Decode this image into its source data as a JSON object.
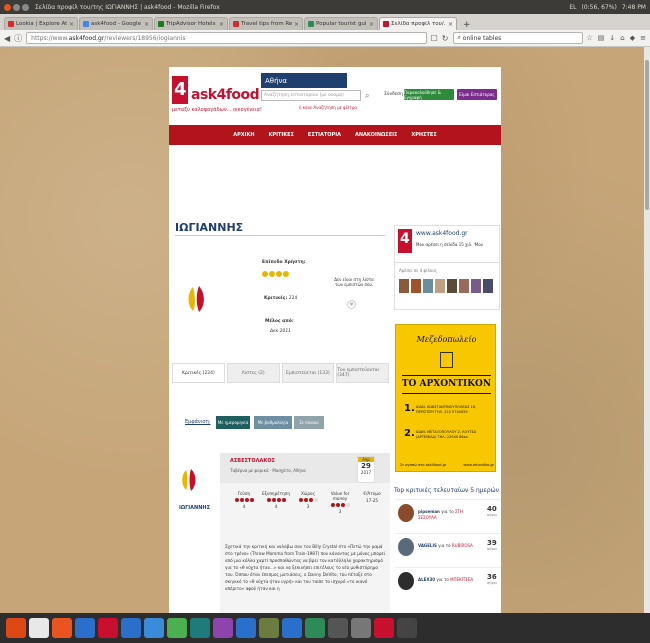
{
  "window_title": "Σελίδα προφίλ του/της ΙΩΓΙΑΝΝΗΣ | ask4food - Mozilla Firefox",
  "tray": {
    "input": "EL",
    "battery": "(0:56, 67%)",
    "time": "7:48 PM"
  },
  "tabs": [
    {
      "label": "Lookia | Explore At...",
      "color": "#d12d2d",
      "active": false
    },
    {
      "label": "ask4food - Google S...",
      "color": "#4285f4",
      "active": false
    },
    {
      "label": "TripAdvisor Hotels ...",
      "color": "#1f7a1f",
      "active": false
    },
    {
      "label": "Travel tips from Re...",
      "color": "#d12d2d",
      "active": false
    },
    {
      "label": "Popular tourist gui...",
      "color": "#2e8b57",
      "active": false
    },
    {
      "label": "Σελίδα προφίλ του/...",
      "color": "#c8102e",
      "active": true
    }
  ],
  "nav": {
    "url_prefix": "https://www.",
    "url_domain": "ask4food.gr",
    "url_path": "/reviewers/18956/iogiannis",
    "search_text": "online tables"
  },
  "site": {
    "logo": "ask4food",
    "tagline": "μεταξύ καλοφαγάδων... οικογένεια!",
    "city": "Αθήνα",
    "search_placeholder": "Αναζήτηση εστιατορίου (με ονομα)",
    "advanced_search": "ή κάνε Αναζήτηση με φίλτρα",
    "login": "Σύνδεση",
    "register_btn": "Παρακολούθησε & Εγγραφή",
    "owners_btn": "Είμαι Εστιάτορας",
    "menu": [
      "ΑΡΧΙΚΗ",
      "ΚΡΙΤΙΚΕΣ",
      "ΕΣΤΙΑΤΟΡΙΑ",
      "ΑΝΑΚΟΙΝΩΣΕΙΣ",
      "ΧΡΗΣΤΕΣ"
    ]
  },
  "profile": {
    "name": "ΙΩΓΙΑΝΝΗΣ",
    "level_label": "Επίπεδο Χρήστη:",
    "stars": 4,
    "reviews_label": "Κριτικές:",
    "reviews_count": "224",
    "member_label": "Μέλος από:",
    "member_since": "Δεκ 2011",
    "secret_note": "Δεν είναι στη λίστα των εμπιστών σου."
  },
  "profile_tabs": [
    {
      "label": "Κριτικές (224)",
      "active": true
    },
    {
      "label": "Λίστες (2)",
      "active": false
    },
    {
      "label": "Εμπιστεύεται (133)",
      "active": false
    },
    {
      "label": "Τον εμπιστεύονται (347)",
      "active": false
    }
  ],
  "filter": {
    "label": "Εμφάνιση:",
    "options": [
      {
        "label": "Με ημερομηνία",
        "color": "#1f5f5f"
      },
      {
        "label": "Με βαθμολογία",
        "color": "#6e8fa3"
      },
      {
        "label": "Σε πίνακα",
        "color": "#8fa3a8"
      }
    ]
  },
  "review": {
    "restaurant": "ΑΣΒΕΣΤΟΛΑΚΟΣ",
    "subtitle": "Ταβέρνα με ψαρικά · Μοσχάτο, Αθήνα",
    "date_month": "Απρ",
    "date_day": "29",
    "date_year": "2017",
    "author": "ΙΩΓΙΑΝΝΗΣ",
    "ratings": [
      {
        "label": "Γεύση",
        "score": 4
      },
      {
        "label": "Εξυπηρέτηση",
        "score": 4
      },
      {
        "label": "Χώρος",
        "score": 3
      },
      {
        "label": "Value for money",
        "score": 3
      },
      {
        "label": "€/Άτομο",
        "score": null,
        "value": "17-25"
      }
    ],
    "text": "Σχετικά την κριτική και ναλάβω σαν τον Billy Crystal στο «Πετώ την μαμά στο τρένο» (Throw Momma from Train-1987) που κάνοντας με μόνος μπορεί από μια κόλλα χαρτί προσπαθώντας να βρει τον κατάλληλο χαρακτηρισμό για το «θ νύχτα ήταν...» και να ξεκινήσει επιτέλους το νέο μυθιστόρημα του. Όσπου όταν έπεσμος ματιάσεις, ο Danny DeVito, του πέταξε στο σκηνικό το «θ νύχτα ήταν υγρή» και του ταίπε το ισχυρό «το ικανό απέριτο» αφού ήταν και η"
  },
  "sidebar": {
    "fb_name": "www.ask4food.gr",
    "fb_like": "Μου αρέσει η σελίδα   15 χιλ. 'Μου",
    "fb_fans": "Αρέσει σε 4 φίλους",
    "ad": {
      "title": "Μεζεδοπωλείο",
      "name": "ΤΟ ΑΡΧΟΝΤΙΚΟΝ",
      "branch1": "ΙΩΑΝ. ΚΩΝΣΤΑΝΤΙΝΟΥΠΟΛΕΩΣ 16, ΠΕΡΙΣΤΕΡΙ ΤΗΛ. 210 5740059",
      "branch2": "ΙΩΑΝ. ΜΕΤΑΞΟΠΟΥΛΟΥ 2, ΛΟΥΤΣΑ (ΑΡΤΕΜΙΔΑ) ΤΗΛ. 22940 86xx",
      "web1": "Σε αγαπώ στο ask4food.gr",
      "web2": "www.arhontiko.gr"
    },
    "top_title": "Top κριτικές τελευταίων 5 ημερών",
    "top": [
      {
        "user": "pipseman",
        "connector": "για το",
        "place": "ΣΤΗ ΣΕΣΟΥΛΑ",
        "count": "40",
        "unit": "ψήφοι",
        "color": "#8b4b2b"
      },
      {
        "user": "VAGELIS",
        "connector": "για το",
        "place": "RUBIROSA",
        "count": "39",
        "unit": "ψήφοι",
        "color": "#5a6a7a"
      },
      {
        "user": "ALEX30",
        "connector": "για το",
        "place": "ΜΠΕΚΙΤΣΕΑ",
        "count": "36",
        "unit": "ψήφοι",
        "color": "#2d2d2d"
      }
    ]
  },
  "dock": [
    "#dd4814",
    "#e8e8e8",
    "#e95420",
    "#2a6fc9",
    "#c8102e",
    "#2a6fc9",
    "#3a8bd9",
    "#4caf50",
    "#1f7a7a",
    "#8e44ad",
    "#2a6fc9",
    "#6b7c3f",
    "#2a6fc9",
    "#2e8b57",
    "#555555",
    "#777777",
    "#c8102e",
    "#444444"
  ]
}
